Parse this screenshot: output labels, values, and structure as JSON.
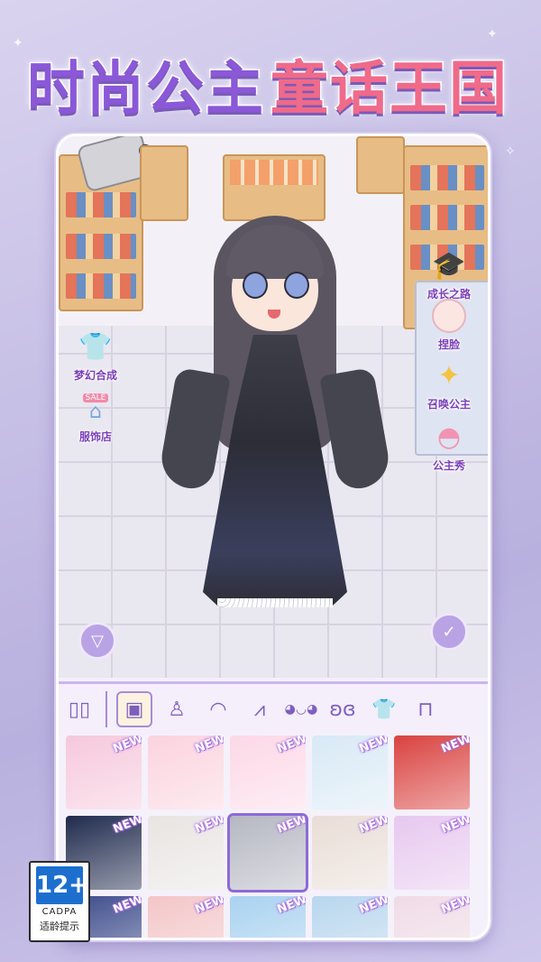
{
  "banner": {
    "title_part1": "时尚公主",
    "title_part2": "童话王国"
  },
  "side_left": [
    {
      "label": "梦幻合成",
      "icon": "clothes-merge-icon"
    },
    {
      "label": "服饰店",
      "icon": "shop-sale-icon",
      "sign": "SALE"
    }
  ],
  "side_right": [
    {
      "label": "成长之路",
      "icon": "graduation-cap-icon"
    },
    {
      "label": "捏脸",
      "icon": "face-edit-icon"
    },
    {
      "label": "召唤公主",
      "icon": "magic-wand-icon"
    },
    {
      "label": "公主秀",
      "icon": "fan-icon"
    }
  ],
  "buttons": {
    "down": "▽",
    "confirm": "✓"
  },
  "categories": [
    {
      "name": "wardrobe-icon",
      "glyph": "▯▯"
    },
    {
      "name": "background-icon",
      "glyph": "▣",
      "active": true
    },
    {
      "name": "dress-icon",
      "glyph": "♙"
    },
    {
      "name": "hair-icon",
      "glyph": "◠"
    },
    {
      "name": "back-hair-icon",
      "glyph": "⩘"
    },
    {
      "name": "eyes-icon",
      "glyph": "◕◡◕"
    },
    {
      "name": "wings-icon",
      "glyph": "ʚɞ"
    },
    {
      "name": "top-icon",
      "glyph": "👕"
    },
    {
      "name": "pants-icon",
      "glyph": "⊓"
    }
  ],
  "tiles_new_label": "NEW",
  "tiles": [
    {
      "color": "#f6c8dc",
      "new": true
    },
    {
      "color": "#fbd3df",
      "new": true
    },
    {
      "color": "#fcd8e6",
      "new": true
    },
    {
      "color": "#d8e9f5",
      "new": true
    },
    {
      "color": "#d9423f",
      "new": true
    },
    {
      "color": "#1f2a4d",
      "new": true
    },
    {
      "color": "#e8e4e2",
      "new": true
    },
    {
      "color": "#b5b7c2",
      "new": true,
      "selected": true
    },
    {
      "color": "#e9ddd6",
      "new": true
    },
    {
      "color": "#e7c8ef",
      "new": true
    },
    {
      "color": "#3b4a8a",
      "new": true
    },
    {
      "color": "#f3c6c8",
      "new": true
    },
    {
      "color": "#a9d2f0",
      "new": true
    },
    {
      "color": "#b8d6ee",
      "new": true
    },
    {
      "color": "#f0dbe6",
      "new": true
    }
  ],
  "age_rating": {
    "number": "12+",
    "org": "CADPA",
    "hint": "适龄提示"
  }
}
